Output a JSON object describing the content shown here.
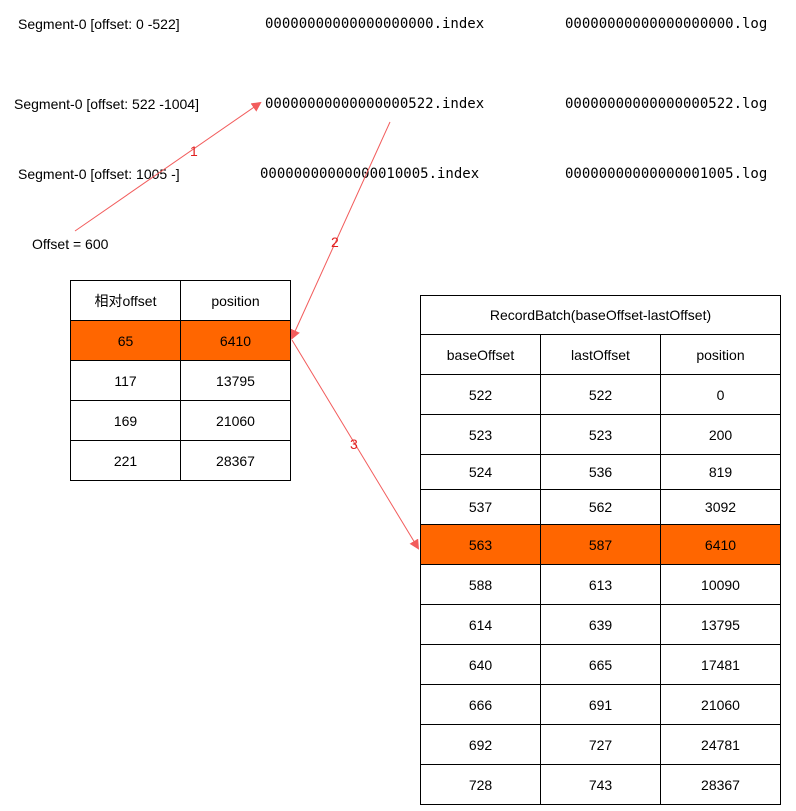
{
  "segments": [
    {
      "label": "Segment-0 [offset: 0 -522]",
      "index_file": "00000000000000000000.index",
      "log_file": "00000000000000000000.log"
    },
    {
      "label": "Segment-0 [offset: 522 -1004]",
      "index_file": "00000000000000000522.index",
      "log_file": "00000000000000000522.log"
    },
    {
      "label": "Segment-0 [offset: 1005 -]",
      "index_file": "00000000000000010005.index",
      "log_file": "00000000000000001005.log"
    }
  ],
  "query_offset": "Offset = 600",
  "steps": [
    "1",
    "2",
    "3"
  ],
  "index_table": {
    "headers": [
      "相对offset",
      "position"
    ],
    "rows": [
      [
        "65",
        "6410"
      ],
      [
        "117",
        "13795"
      ],
      [
        "169",
        "21060"
      ],
      [
        "221",
        "28367"
      ]
    ],
    "highlight_row": 0
  },
  "batch_table": {
    "caption": "RecordBatch(baseOffset-lastOffset)",
    "headers": [
      "baseOffset",
      "lastOffset",
      "position"
    ],
    "rows": [
      [
        "522",
        "522",
        "0"
      ],
      [
        "523",
        "523",
        "200"
      ],
      [
        "524",
        "536",
        "819"
      ],
      [
        "537",
        "562",
        "3092"
      ],
      [
        "563",
        "587",
        "6410"
      ],
      [
        "588",
        "613",
        "10090"
      ],
      [
        "614",
        "639",
        "13795"
      ],
      [
        "640",
        "665",
        "17481"
      ],
      [
        "666",
        "691",
        "21060"
      ],
      [
        "692",
        "727",
        "24781"
      ],
      [
        "728",
        "743",
        "28367"
      ]
    ],
    "highlight_row": 4
  },
  "colors": {
    "highlight": "#ff6600",
    "arrow": "#f25c5c",
    "step_label": "#e02020"
  }
}
